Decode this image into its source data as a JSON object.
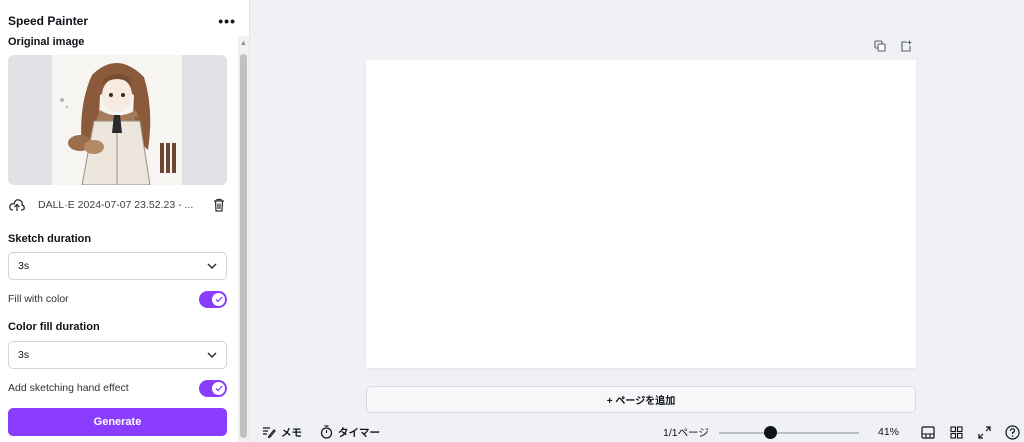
{
  "panel": {
    "title": "Speed Painter",
    "more_label": "•••",
    "original_image_label": "Original image",
    "file_name": "DALL·E 2024-07-07 23.52.23 - ...",
    "sketch_duration_label": "Sketch duration",
    "sketch_duration_value": "3s",
    "fill_color_label": "Fill with color",
    "fill_color_on": true,
    "color_fill_duration_label": "Color fill duration",
    "color_fill_duration_value": "3s",
    "hand_effect_label": "Add sketching hand effect",
    "hand_effect_on": true,
    "generate_label": "Generate"
  },
  "canvas": {
    "add_page_label": "+ ページを追加"
  },
  "bottom_bar": {
    "memo_label": "メモ",
    "timer_label": "タイマー",
    "page_count": "1/1ページ",
    "zoom_value": "41%",
    "zoom_level": 0.41
  },
  "colors": {
    "accent": "#8b3dff",
    "canvas_bg": "#f0f1f5"
  }
}
